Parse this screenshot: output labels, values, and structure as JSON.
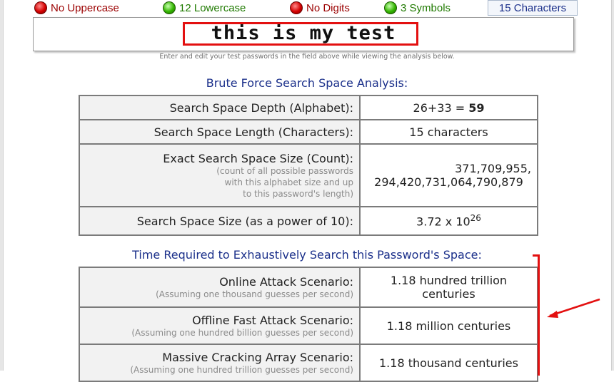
{
  "indicators": [
    {
      "label": "No Uppercase",
      "status": "red"
    },
    {
      "label": "12 Lowercase",
      "status": "green"
    },
    {
      "label": "No Digits",
      "status": "red"
    },
    {
      "label": "3 Symbols",
      "status": "green"
    }
  ],
  "char_count": "15 Characters",
  "password": "this is my test",
  "hint": "Enter and edit your test passwords in the field above while viewing the analysis below.",
  "brute_force": {
    "title": "Brute Force Search Space Analysis:",
    "depth_label": "Search Space Depth (Alphabet):",
    "depth_value_prefix": "26+33 = ",
    "depth_value_bold": "59",
    "length_label": "Search Space Length (Characters):",
    "length_value": "15 characters",
    "exact_label": "Exact Search Space Size (Count):",
    "exact_note_1": "(count of all possible passwords",
    "exact_note_2": "with this alphabet size and up",
    "exact_note_3": "to this password's length)",
    "exact_value_1": "371,709,955,",
    "exact_value_2": "294,420,731,064,790,879",
    "power_label": "Search Space Size (as a power of 10):",
    "power_base": "3.72 x 10",
    "power_exp": "26"
  },
  "time_required": {
    "title": "Time Required to Exhaustively Search this Password's Space:",
    "rows": [
      {
        "label": "Online Attack Scenario:",
        "note": "(Assuming one thousand guesses per second)",
        "value_1": "1.18 hundred trillion",
        "value_2": "centuries"
      },
      {
        "label": "Offline Fast Attack Scenario:",
        "note": "(Assuming one hundred billion guesses per second)",
        "value_1": "1.18 million centuries",
        "value_2": ""
      },
      {
        "label": "Massive Cracking Array Scenario:",
        "note": "(Assuming one hundred trillion guesses per second)",
        "value_1": "1.18 thousand centuries",
        "value_2": ""
      }
    ]
  },
  "colors": {
    "accent_red": "#e31010",
    "title_blue": "#1a2f8a"
  }
}
